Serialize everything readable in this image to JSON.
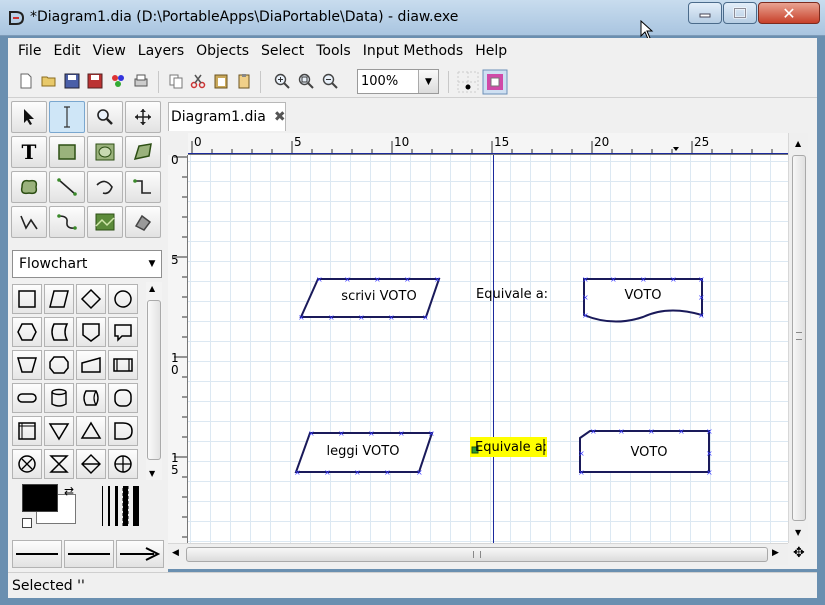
{
  "window": {
    "title": "*Diagram1.dia (D:\\PortableApps\\DiaPortable\\Data) - diaw.exe"
  },
  "menu": {
    "items": [
      "File",
      "Edit",
      "View",
      "Layers",
      "Objects",
      "Select",
      "Tools",
      "Input Methods",
      "Help"
    ]
  },
  "toolbar": {
    "zoom_value": "100%"
  },
  "toolbox": {
    "sheet_name": "Flowchart"
  },
  "tabs": [
    {
      "label": "Diagram1.dia"
    }
  ],
  "rulers": {
    "horizontal": [
      "0",
      "5",
      "10",
      "15",
      "20",
      "25"
    ],
    "vertical": [
      "0",
      "5",
      "1",
      "0",
      "1",
      "5"
    ]
  },
  "diagram": {
    "shapes": [
      {
        "type": "parallelogram",
        "text": "scrivi VOTO"
      },
      {
        "type": "text",
        "text": "Equivale a:"
      },
      {
        "type": "document",
        "text": "VOTO"
      },
      {
        "type": "parallelogram",
        "text": "leggi VOTO"
      },
      {
        "type": "text-selected",
        "text": "Equivale a:"
      },
      {
        "type": "manual-input",
        "text": "VOTO"
      }
    ]
  },
  "status": {
    "text": "Selected ''"
  },
  "colors": {
    "selection_highlight": "#ffff00",
    "guide_line": "#1b2a9c",
    "connection_point": "#3c3cff"
  }
}
